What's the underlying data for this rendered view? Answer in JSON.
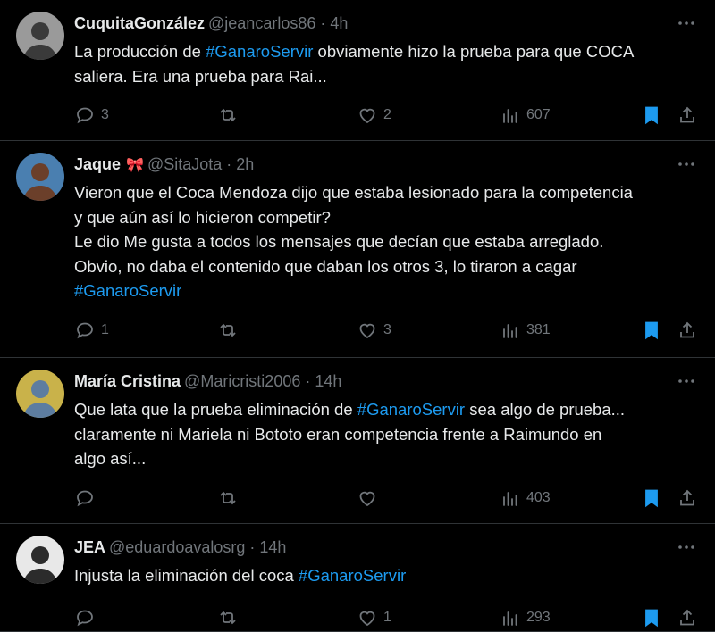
{
  "tweets": [
    {
      "name": "CuquitaGonzález",
      "emoji": "",
      "handle": "@jeancarlos86",
      "time": "4h",
      "lines": [
        [
          {
            "t": "La producción de "
          },
          {
            "t": "#GanaroServir",
            "tag": true
          },
          {
            "t": " obviamente hizo la prueba para que COCA"
          }
        ],
        [
          {
            "t": "saliera. Era una prueba para Rai..."
          }
        ]
      ],
      "replies": "3",
      "retweets": "",
      "likes": "2",
      "views": "607",
      "avatar": {
        "bg": "#9a9a9a",
        "fg": "#3a3a3a",
        "icon": "avatar-photo"
      }
    },
    {
      "name": "Jaque",
      "emoji": "🎀",
      "handle": "@SitaJota",
      "time": "2h",
      "lines": [
        [
          {
            "t": "Vieron que el Coca Mendoza dijo que estaba lesionado para la competencia"
          }
        ],
        [
          {
            "t": "y que aún así lo hicieron competir?"
          }
        ],
        [
          {
            "t": "Le dio Me gusta a todos los mensajes que decían que estaba arreglado."
          }
        ],
        [
          {
            "t": "Obvio, no daba el contenido que daban los otros 3, lo tiraron a cagar"
          }
        ],
        [
          {
            "t": "#GanaroServir",
            "tag": true
          }
        ]
      ],
      "replies": "1",
      "retweets": "",
      "likes": "3",
      "views": "381",
      "avatar": {
        "bg": "#4a7fb0",
        "fg": "#6b3f2a",
        "icon": "avatar-photo"
      }
    },
    {
      "name": "María Cristina",
      "emoji": "",
      "handle": "@Maricristi2006",
      "time": "14h",
      "lines": [
        [
          {
            "t": "Que lata que la prueba eliminación de "
          },
          {
            "t": "#GanaroServir",
            "tag": true
          },
          {
            "t": " sea algo de prueba..."
          }
        ],
        [
          {
            "t": "claramente ni Mariela ni Bototo eran competencia frente a Raimundo en"
          }
        ],
        [
          {
            "t": "algo así..."
          }
        ]
      ],
      "replies": "",
      "retweets": "",
      "likes": "",
      "views": "403",
      "avatar": {
        "bg": "#c9b24a",
        "fg": "#5d7da0",
        "icon": "avatar-photo"
      }
    },
    {
      "name": "JEA",
      "emoji": "",
      "handle": "@eduardoavalosrg",
      "time": "14h",
      "lines": [
        [
          {
            "t": "Injusta la eliminación del coca "
          },
          {
            "t": "#GanaroServir",
            "tag": true
          }
        ]
      ],
      "replies": "",
      "retweets": "",
      "likes": "1",
      "views": "293",
      "avatar": {
        "bg": "#e8e8e8",
        "fg": "#2b2b2b",
        "icon": "avatar-photo"
      }
    }
  ],
  "colors": {
    "accent": "#1d9bf0",
    "muted": "#71767b",
    "text": "#e7e9ea",
    "divider": "#2f3336"
  }
}
